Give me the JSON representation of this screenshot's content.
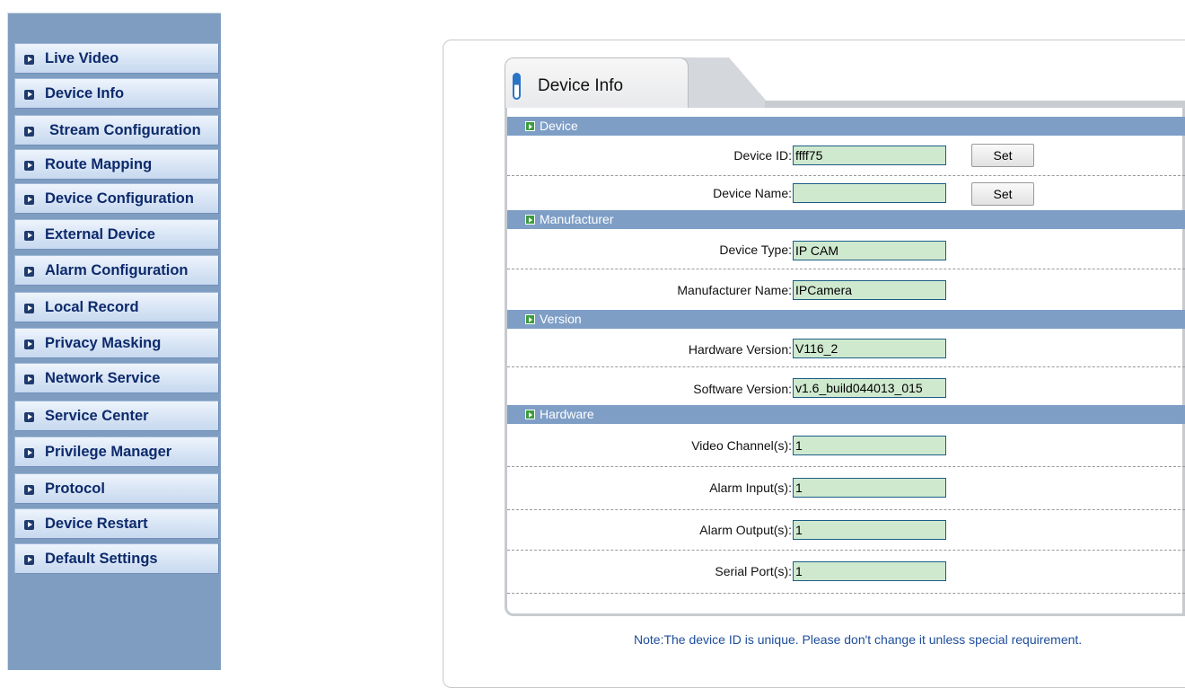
{
  "sidebar": {
    "items": [
      {
        "label": "Live Video"
      },
      {
        "label": "Device Info"
      },
      {
        "label": "Stream Configuration"
      },
      {
        "label": "Route Mapping"
      },
      {
        "label": "Device Configuration"
      },
      {
        "label": "External Device"
      },
      {
        "label": "Alarm Configuration"
      },
      {
        "label": "Local Record"
      },
      {
        "label": "Privacy Masking"
      },
      {
        "label": "Network Service"
      },
      {
        "label": "Service Center"
      },
      {
        "label": "Privilege Manager"
      },
      {
        "label": "Protocol"
      },
      {
        "label": "Device Restart"
      },
      {
        "label": "Default Settings"
      }
    ]
  },
  "tab": {
    "title": "Device Info"
  },
  "sections": {
    "device": {
      "title": "Device",
      "device_id_label": "Device ID:",
      "device_id_value": "ffff75",
      "device_name_label": "Device Name:",
      "device_name_value": "",
      "set_label": "Set"
    },
    "manufacturer": {
      "title": "Manufacturer",
      "device_type_label": "Device Type:",
      "device_type_value": "IP CAM",
      "manufacturer_name_label": "Manufacturer Name:",
      "manufacturer_name_value": "IPCamera"
    },
    "version": {
      "title": "Version",
      "hardware_label": "Hardware Version:",
      "hardware_value": "V116_2",
      "software_label": "Software Version:",
      "software_value": "v1.6_build044013_015"
    },
    "hardware": {
      "title": "Hardware",
      "video_label": "Video Channel(s):",
      "video_value": "1",
      "alarm_in_label": "Alarm Input(s):",
      "alarm_in_value": "1",
      "alarm_out_label": "Alarm Output(s):",
      "alarm_out_value": "1",
      "serial_label": "Serial Port(s):",
      "serial_value": "1"
    }
  },
  "note": "Note:The device ID is unique. Please don't change it unless special requirement.",
  "colors": {
    "sidebar_bg": "#7f9dc0",
    "section_header": "#7e9ec6",
    "field_bg": "#cfe9cf",
    "note_text": "#1c4d9c"
  }
}
